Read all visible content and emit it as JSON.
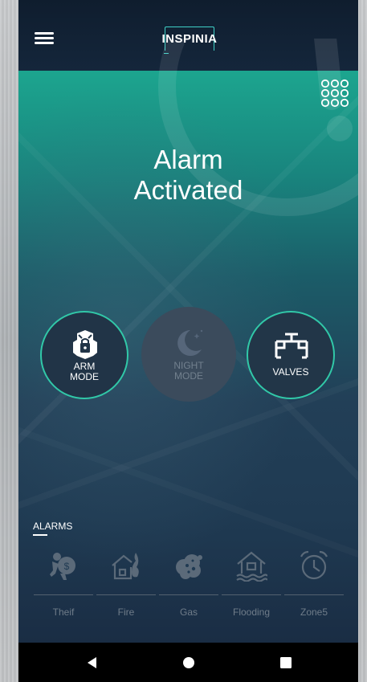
{
  "header": {
    "logo_text": "INSPINIA",
    "menu_icon": "hamburger-menu-icon"
  },
  "status": {
    "line1": "Alarm",
    "line2": "Activated"
  },
  "modes": [
    {
      "line1": "ARM",
      "line2": "MODE",
      "icon": "knight-armor-icon",
      "active": true
    },
    {
      "line1": "NIGHT",
      "line2": "MODE",
      "icon": "moon-stars-icon",
      "active": false
    },
    {
      "line1": "VALVES",
      "icon": "valve-pipe-icon",
      "active": true
    }
  ],
  "alarms": {
    "title": "ALARMS",
    "items": [
      {
        "label": "Theif",
        "icon": "thief-icon"
      },
      {
        "label": "Fire",
        "icon": "house-fire-icon"
      },
      {
        "label": "Gas",
        "icon": "gas-cloud-icon"
      },
      {
        "label": "Flooding",
        "icon": "house-flood-icon"
      },
      {
        "label": "Zone5",
        "icon": "alarm-clock-icon"
      }
    ]
  },
  "colors": {
    "accent": "#31c8a8",
    "logo_accent": "#3fd0c6",
    "header_bg": "#0f1d2e",
    "inactive_text": "#6f7c89"
  }
}
